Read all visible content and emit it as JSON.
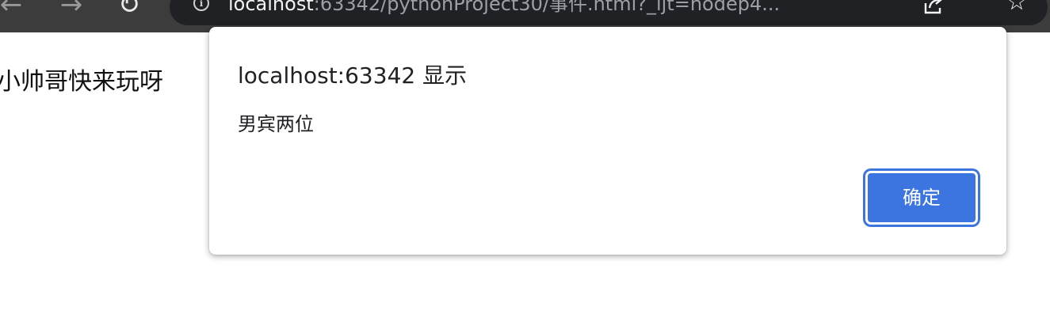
{
  "browser": {
    "url_host": "localhost",
    "url_rest": ":63342/pythonProject30/事件.html?_ijt=nodep4...",
    "icons": {
      "back": "arrow-left-icon",
      "forward": "arrow-right-icon",
      "reload": "reload-icon",
      "site_info": "info-circle-icon",
      "share": "share-icon",
      "bookmark": "star-icon"
    }
  },
  "page": {
    "text": "小帅哥快来玩呀"
  },
  "dialog": {
    "title": "localhost:63342 显示",
    "message": "男宾两位",
    "ok_label": "确定"
  },
  "colors": {
    "toolbar_bg": "#3c3c3c",
    "omnibox_bg": "#202124",
    "button_accent": "#3c74e0"
  }
}
